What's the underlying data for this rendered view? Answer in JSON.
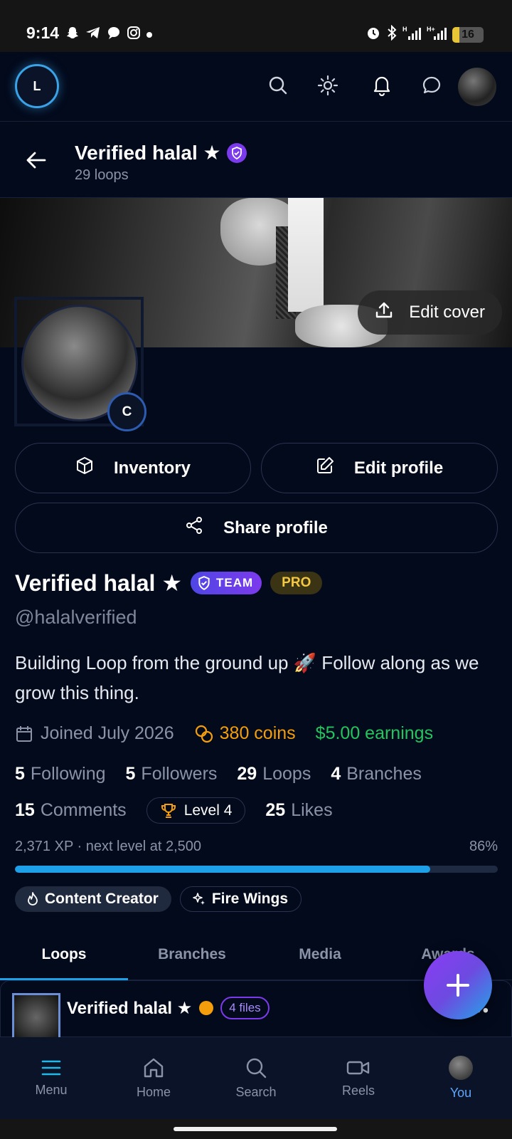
{
  "status": {
    "time": "9:14",
    "battery": "16",
    "left_icons": [
      "snapchat-icon",
      "telegram-icon",
      "threads-icon",
      "instagram-icon",
      "dot-icon"
    ],
    "right_icons": [
      "alarm-icon",
      "bluetooth-icon",
      "signal-h-icon",
      "signal-hplus-icon",
      "battery-icon"
    ]
  },
  "topbar": {
    "logo_letter": "L",
    "icons": [
      "search-icon",
      "sun-icon",
      "bell-icon",
      "chat-icon"
    ]
  },
  "pagehead": {
    "title": "Verified halal ★",
    "subtitle": "29 loops"
  },
  "cover": {
    "edit_label": "Edit cover"
  },
  "profile": {
    "avatar_badge": "C",
    "buttons": {
      "inventory": "Inventory",
      "edit": "Edit profile",
      "share": "Share profile"
    },
    "name": "Verified halal ★",
    "team_badge": "TEAM",
    "pro_badge": "PRO",
    "handle": "@halalverified",
    "bio": "Building Loop from the ground up 🚀 Follow along as we grow this thing.",
    "joined": "Joined July 2026",
    "coins": "380 coins",
    "earnings": "$5.00 earnings",
    "stats": {
      "following_num": "5",
      "following_label": "Following",
      "followers_num": "5",
      "followers_label": "Followers",
      "loops_num": "29",
      "loops_label": "Loops",
      "branches_num": "4",
      "branches_label": "Branches",
      "comments_num": "15",
      "comments_label": "Comments",
      "level": "Level 4",
      "likes_num": "25",
      "likes_label": "Likes"
    },
    "xp_text": "2,371 XP · next level at 2,500",
    "xp_percent": "86%",
    "xp_fraction": 0.86,
    "chips": [
      "Content Creator",
      "Fire Wings"
    ]
  },
  "tabs": [
    "Loops",
    "Branches",
    "Media",
    "Awards"
  ],
  "post": {
    "author": "Verified halal ★",
    "files": "4 files",
    "more": "•••"
  },
  "nav": [
    {
      "label": "Menu",
      "icon": "menu-icon"
    },
    {
      "label": "Home",
      "icon": "home-icon"
    },
    {
      "label": "Search",
      "icon": "search-icon"
    },
    {
      "label": "Reels",
      "icon": "video-icon"
    },
    {
      "label": "You",
      "icon": "avatar"
    }
  ],
  "colors": {
    "accent": "#1ea0e8",
    "coins": "#f59e0b",
    "earnings": "#22c55e",
    "team": "#7c3aed",
    "pro": "#f5c842"
  }
}
